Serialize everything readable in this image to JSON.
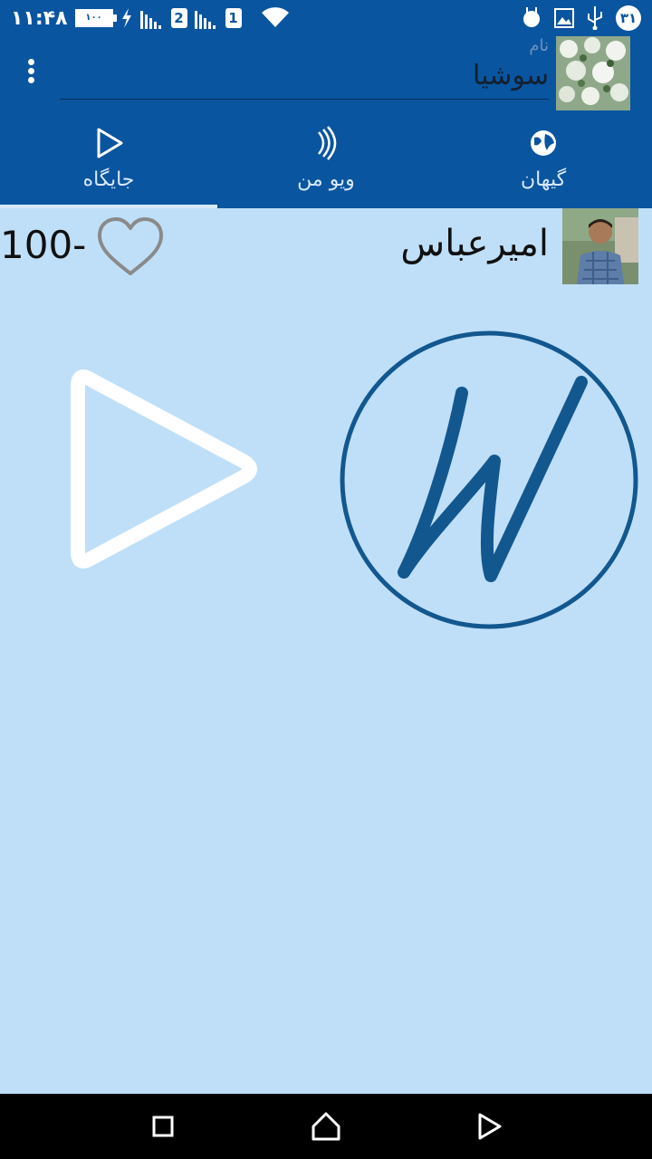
{
  "status_bar": {
    "time": "۱۱:۴۸",
    "battery": "۱۰۰",
    "sim1": "2",
    "sim2": "1",
    "date": "۳۱",
    "icons": [
      "battery-icon",
      "charging-icon",
      "signal-icon",
      "signal-icon",
      "wifi-icon",
      "usb-icon",
      "image-icon",
      "android-icon"
    ]
  },
  "header": {
    "name_hint": "نام",
    "name_value": "سوشیا"
  },
  "tabs": [
    {
      "label": "جایگاه",
      "icon": "play-icon",
      "active": true
    },
    {
      "label": "ویو من",
      "icon": "sound-waves-icon",
      "active": false
    },
    {
      "label": "گیهان",
      "icon": "globe-icon",
      "active": false
    }
  ],
  "user_row": {
    "score": "100-",
    "name": "امیرعباس"
  },
  "colors": {
    "header_bg": "#0a55a0",
    "content_bg": "#bfdff8",
    "logo_blue": "#13578f"
  }
}
